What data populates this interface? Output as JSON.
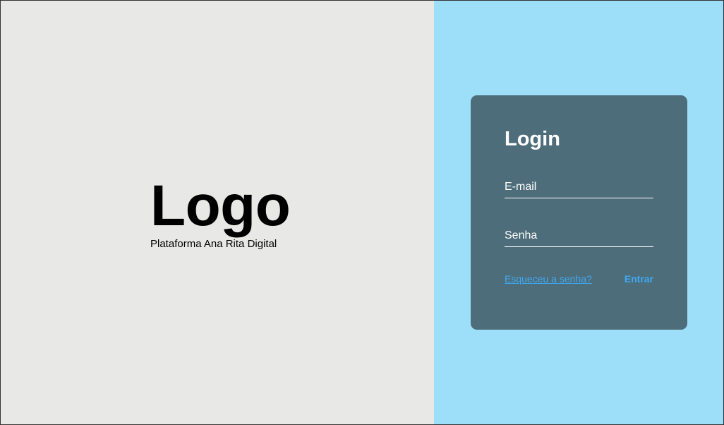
{
  "brand": {
    "logo": "Logo",
    "tagline": "Plataforma Ana Rita Digital"
  },
  "login": {
    "title": "Login",
    "email_placeholder": "E-mail",
    "email_value": "",
    "password_placeholder": "Senha",
    "password_value": "",
    "forgot_label": "Esqueceu a senha?",
    "submit_label": "Entrar"
  },
  "colors": {
    "left_background": "#e8e9e7",
    "right_background": "#9ddff8",
    "card_background": "#4e6d7a",
    "accent": "#3fa9f0",
    "text_light": "#ffffff",
    "text_dark": "#000000"
  }
}
